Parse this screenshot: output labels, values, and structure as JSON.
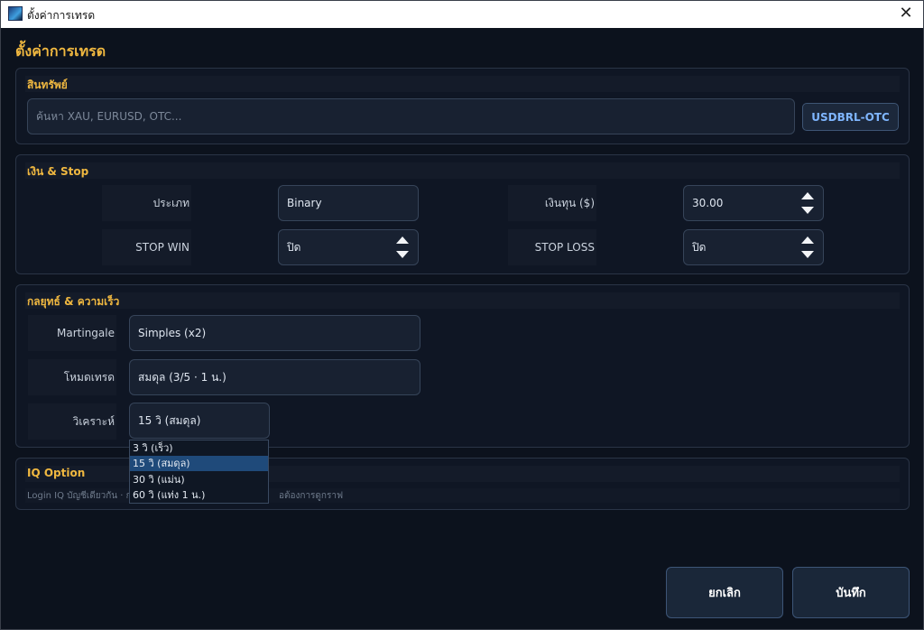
{
  "window": {
    "title": "ตั้งค่าการเทรด"
  },
  "page": {
    "title": "ตั้งค่าการเทรด"
  },
  "asset": {
    "header": "สินทรัพย์",
    "search_placeholder": "ค้นหา XAU, EURUSD, OTC...",
    "selected_button": "USDBRL-OTC"
  },
  "money": {
    "header": "เงิน & Stop",
    "type_label": "ประเภท",
    "type_value": "Binary",
    "amount_label": "เงินทุน ($)",
    "amount_value": "30.00",
    "stop_win_label": "STOP WIN",
    "stop_win_value": "ปิด",
    "stop_loss_label": "STOP LOSS",
    "stop_loss_value": "ปิด"
  },
  "strategy": {
    "header": "กลยุทธ์ & ความเร็ว",
    "martingale_label": "Martingale",
    "martingale_value": "Simples (x2)",
    "mode_label": "โหมดเทรด",
    "mode_value": "สมดุล (3/5 · 1 น.)",
    "analyze_label": "วิเคราะห์",
    "analyze_value": "15 วิ (สมดุล)",
    "analyze_options": [
      "3 วิ (เร็ว)",
      "15 วิ (สมดุล)",
      "30 วิ (แม่น)",
      "60 วิ (แท่ง 1 น.)"
    ],
    "analyze_selected_index": 1
  },
  "iq": {
    "header": "IQ Option",
    "desc_left": "Login IQ บัญชีเดียวกัน · ก",
    "desc_right": "อต้องการดูกราฟ"
  },
  "footer": {
    "cancel_label": "ยกเลิก",
    "save_label": "บันทึก"
  },
  "colors": {
    "accent": "#f0b840",
    "asset_button_text": "#7fb6ff",
    "selected_option": "#1f4a7a"
  }
}
